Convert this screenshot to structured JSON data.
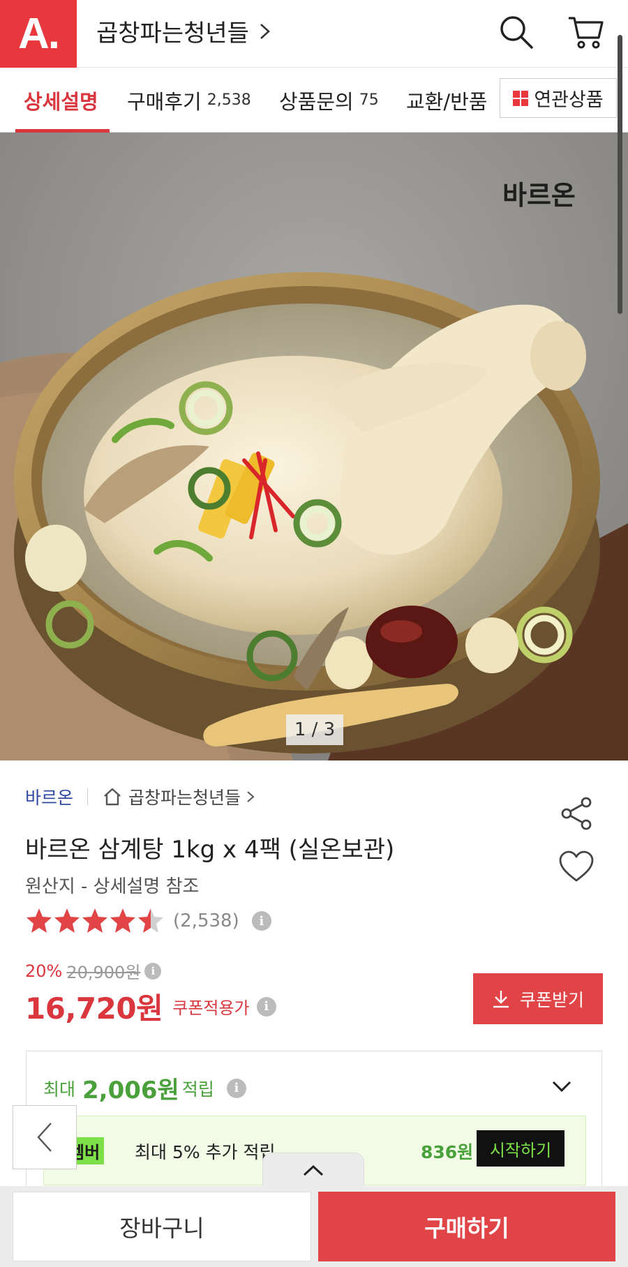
{
  "header": {
    "logo_text": "A.",
    "store_title": "곱창파는청년들",
    "icons": [
      "search-icon",
      "cart-icon"
    ],
    "brand_color": "#e8383d"
  },
  "tabs": [
    {
      "label": "상세설명",
      "count": "",
      "active": true
    },
    {
      "label": "구매후기",
      "count": "2,538",
      "active": false
    },
    {
      "label": "상품문의",
      "count": "75",
      "active": false
    },
    {
      "label": "교환/반품",
      "count": "",
      "active": false
    }
  ],
  "related_button": {
    "label": "연관상품",
    "icon": "grid-icon"
  },
  "gallery": {
    "watermark": "바르온",
    "counter": "1 / 3"
  },
  "product": {
    "brand": "바르온",
    "store": "곱창파는청년들",
    "title": "바르온 삼계탕 1kg x 4팩 (실온보관)",
    "origin": "원산지 - 상세설명 참조",
    "rating": 4.5,
    "review_count": "(2,538)",
    "discount_pct": "20%",
    "original_price": "20,900원",
    "price": "16,720원",
    "coupon_price_label": "쿠폰적용가",
    "coupon_button": "쿠폰받기",
    "icons": [
      "share-icon",
      "heart-icon",
      "home-icon",
      "info-icon"
    ]
  },
  "reward": {
    "prefix": "최대",
    "amount": "2,006원",
    "suffix": "적립",
    "member_badge": "멤버",
    "member_text": "최대 5% 추가 적립",
    "member_amount": "836원",
    "start_button": "시작하기",
    "accent_color": "#4aa03a"
  },
  "bottom": {
    "cart_label": "장바구니",
    "buy_label": "구매하기",
    "buy_color": "#e14446"
  }
}
